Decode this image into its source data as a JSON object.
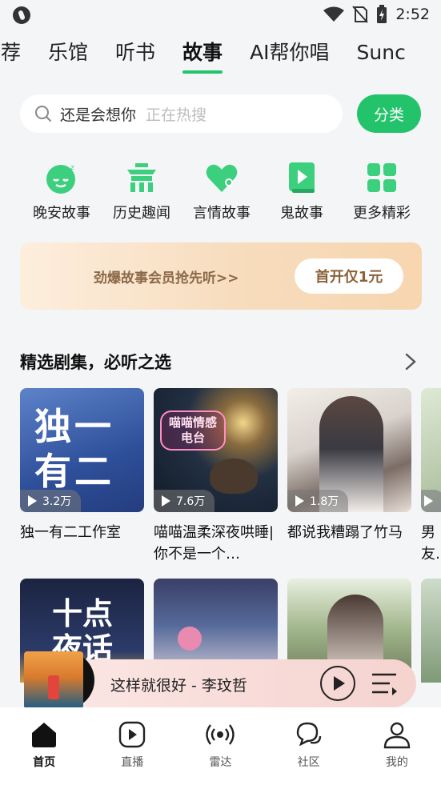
{
  "status_bar": {
    "time": "2:52"
  },
  "tabs": [
    {
      "label": "推荐",
      "partial": "推荐"
    },
    {
      "label": "乐馆"
    },
    {
      "label": "听书"
    },
    {
      "label": "故事"
    },
    {
      "label": "AI帮你唱"
    },
    {
      "label": "Sunc"
    }
  ],
  "search": {
    "query": "还是会想你",
    "hint": "正在热搜"
  },
  "category_button": "分类",
  "quick_links": [
    {
      "label": "晚安故事",
      "icon": "sleep-face-icon"
    },
    {
      "label": "历史趣闻",
      "icon": "temple-icon"
    },
    {
      "label": "言情故事",
      "icon": "heart-icon"
    },
    {
      "label": "鬼故事",
      "icon": "play-book-icon"
    },
    {
      "label": "更多精彩",
      "icon": "grid-icon"
    }
  ],
  "banner": {
    "text": "劲爆故事会员抢先听>>",
    "button": "首开仅1元"
  },
  "section": {
    "title": "精选剧集，必听之选"
  },
  "cards": [
    {
      "title": "独一有二工作室",
      "plays": "3.2万",
      "cover_text": "独一有二"
    },
    {
      "title": "喵喵温柔深夜哄睡|你不是一个…",
      "plays": "7.6万",
      "cover_text": "喵喵情感电台"
    },
    {
      "title": "都说我糟蹋了竹马",
      "plays": "1.8万"
    },
    {
      "title": "男友转头",
      "plays": ""
    }
  ],
  "row2_cover_text": "十点夜话",
  "player": {
    "song": "这样就很好 - 李玟哲"
  },
  "bottom_nav": [
    {
      "label": "首页",
      "icon": "home-icon",
      "active": true
    },
    {
      "label": "直播",
      "icon": "live-play-icon"
    },
    {
      "label": "雷达",
      "icon": "radar-icon"
    },
    {
      "label": "社区",
      "icon": "community-chat-icon"
    },
    {
      "label": "我的",
      "icon": "profile-icon"
    }
  ],
  "colors": {
    "accent": "#22c36b",
    "banner_text": "#8b6a48"
  }
}
